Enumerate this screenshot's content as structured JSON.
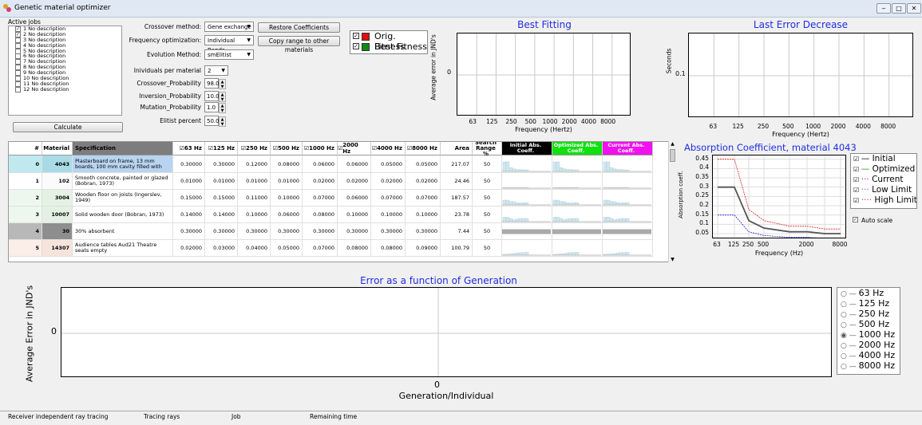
{
  "window": {
    "title": "Genetic material optimizer",
    "min": "‒",
    "max": "□",
    "close": "✕"
  },
  "jobs": {
    "label": "Active jobs",
    "items": [
      {
        "label": "1 No description",
        "checked": true
      },
      {
        "label": "2 No description",
        "checked": true
      },
      {
        "label": "3 No description",
        "checked": false
      },
      {
        "label": "4 No description",
        "checked": false
      },
      {
        "label": "5 No description",
        "checked": false
      },
      {
        "label": "6 No description",
        "checked": false
      },
      {
        "label": "7 No description",
        "checked": false
      },
      {
        "label": "8 No description",
        "checked": false
      },
      {
        "label": "9 No description",
        "checked": false
      },
      {
        "label": "10 No description",
        "checked": false
      },
      {
        "label": "11 No description",
        "checked": false
      },
      {
        "label": "12 No description",
        "checked": false
      }
    ],
    "calculate": "Calculate"
  },
  "settings": {
    "crossover_method_label": "Crossover method:",
    "crossover_method": "Gene exchange",
    "freq_opt_label": "Frequency optimization:",
    "freq_opt": "Individual Bands",
    "evolution_label": "Evolution Method:",
    "evolution": "smElitist",
    "individuals_label": "Inividuals per material",
    "individuals": "2",
    "crossover_prob_label": "Crossover_Probability",
    "crossover_prob": "98.0",
    "inversion_prob_label": "Inversion_Probability",
    "inversion_prob": "10.0",
    "mutation_prob_label": "Mutation_Probability",
    "mutation_prob": "1.0",
    "elitist_label": "Elitist percent",
    "elitist": "50.0",
    "restore_btn": "Restore Coefficients",
    "copy_btn": "Copy range to other materials"
  },
  "fitness_legend": [
    {
      "label": "Orig. Fitness",
      "color": "#e01010"
    },
    {
      "label": "Best Fitness",
      "color": "#108a10"
    }
  ],
  "best_fitting": {
    "title": "Best Fitting",
    "ylabel": "Average error in JND's",
    "y0": "0",
    "xlabel": "Frequency (Hertz)",
    "ticks": [
      "63",
      "125",
      "250",
      "500",
      "1000",
      "2000",
      "4000",
      "8000"
    ]
  },
  "last_error": {
    "title": "Last Error Decrease",
    "ylabel": "Seconds",
    "y0": "0.1",
    "xlabel": "Frequency (Hertz)",
    "ticks": [
      "63",
      "125",
      "250",
      "500",
      "1000",
      "2000",
      "4000",
      "8000"
    ]
  },
  "table": {
    "headers": {
      "num": "#",
      "material": "Material",
      "spec": "Specification",
      "f63": "63 Hz",
      "f125": "125 Hz",
      "f250": "250 Hz",
      "f500": "500 Hz",
      "f1000": "1000 Hz",
      "f2000": "2000 Hz",
      "f4000": "4000 Hz",
      "f8000": "8000 Hz",
      "area": "Area",
      "search": "Search Range %",
      "initial": "Initial Abs. Coeff.",
      "optimized": "Optimized Abs. Coeff.",
      "current": "Current Abs. Coeff."
    },
    "rows": [
      {
        "n": "0",
        "mat": "4043",
        "spec": "Plasterboard on frame, 13 mm boards, 100 mm cavity filled with",
        "v": [
          "0.30000",
          "0.30000",
          "0.12000",
          "0.08000",
          "0.06000",
          "0.06000",
          "0.05000",
          "0.05000"
        ],
        "area": "217.07",
        "sr": "50"
      },
      {
        "n": "1",
        "mat": "102",
        "spec": "Smooth concrete, painted or glazed (Bobran, 1973)",
        "v": [
          "0.01000",
          "0.01000",
          "0.01000",
          "0.01000",
          "0.02000",
          "0.02000",
          "0.02000",
          "0.02000"
        ],
        "area": "24.46",
        "sr": "50"
      },
      {
        "n": "2",
        "mat": "3004",
        "spec": "Wooden floor on joists (Ingerslev, 1949)",
        "v": [
          "0.15000",
          "0.15000",
          "0.11000",
          "0.10000",
          "0.07000",
          "0.06000",
          "0.07000",
          "0.07000"
        ],
        "area": "187.57",
        "sr": "50"
      },
      {
        "n": "3",
        "mat": "10007",
        "spec": "Solid wooden door (Bobran, 1973)",
        "v": [
          "0.14000",
          "0.14000",
          "0.10000",
          "0.06000",
          "0.08000",
          "0.10000",
          "0.10000",
          "0.10000"
        ],
        "area": "23.78",
        "sr": "50"
      },
      {
        "n": "4",
        "mat": "30",
        "spec": "30% absorbent",
        "v": [
          "0.30000",
          "0.30000",
          "0.30000",
          "0.30000",
          "0.30000",
          "0.30000",
          "0.30000",
          "0.30000"
        ],
        "area": "7.44",
        "sr": "50"
      },
      {
        "n": "5",
        "mat": "14307",
        "spec": "Audience tables Aud21 Theatre seats empty",
        "v": [
          "0.02000",
          "0.03000",
          "0.04000",
          "0.05000",
          "0.07000",
          "0.08000",
          "0.08000",
          "0.09000"
        ],
        "area": "100.79",
        "sr": "50"
      }
    ]
  },
  "absorption": {
    "title": "Absorption Coefficient, material 4043",
    "ylabel": "Absorption coeff.",
    "xlabel": "Frequency (Hz)",
    "yticks": [
      "0.45",
      "0.4",
      "0.35",
      "0.3",
      "0.25",
      "0.2",
      "0.15",
      "0.1",
      "0.05"
    ],
    "xticks": [
      "63",
      "125",
      "250",
      "500",
      "2000",
      "8000"
    ],
    "legend": [
      "Initial",
      "Optimized",
      "Current",
      "Low Limit",
      "High Limit"
    ],
    "autoscale": "Auto scale",
    "series": {
      "initial": [
        0.3,
        0.3,
        0.12,
        0.08,
        0.06,
        0.06,
        0.05,
        0.05
      ],
      "low": [
        0.15,
        0.15,
        0.06,
        0.04,
        0.03,
        0.03,
        0.025,
        0.025
      ],
      "high": [
        0.45,
        0.45,
        0.18,
        0.12,
        0.09,
        0.09,
        0.075,
        0.075
      ]
    }
  },
  "generation": {
    "title": "Error as a function of Generation",
    "ylabel": "Average Error in JND's",
    "y0": "0",
    "x0": "0",
    "xlabel": "Generation/Individual",
    "freqs": [
      {
        "label": "63 Hz",
        "selected": false
      },
      {
        "label": "125 Hz",
        "selected": false
      },
      {
        "label": "250 Hz",
        "selected": false
      },
      {
        "label": "500 Hz",
        "selected": false
      },
      {
        "label": "1000 Hz",
        "selected": true
      },
      {
        "label": "2000 Hz",
        "selected": false
      },
      {
        "label": "4000 Hz",
        "selected": false
      },
      {
        "label": "8000 Hz",
        "selected": false
      }
    ]
  },
  "status": {
    "a": "Receiver independent ray tracing",
    "b": "Tracing rays",
    "c": "Job",
    "d": "Remaining time"
  }
}
